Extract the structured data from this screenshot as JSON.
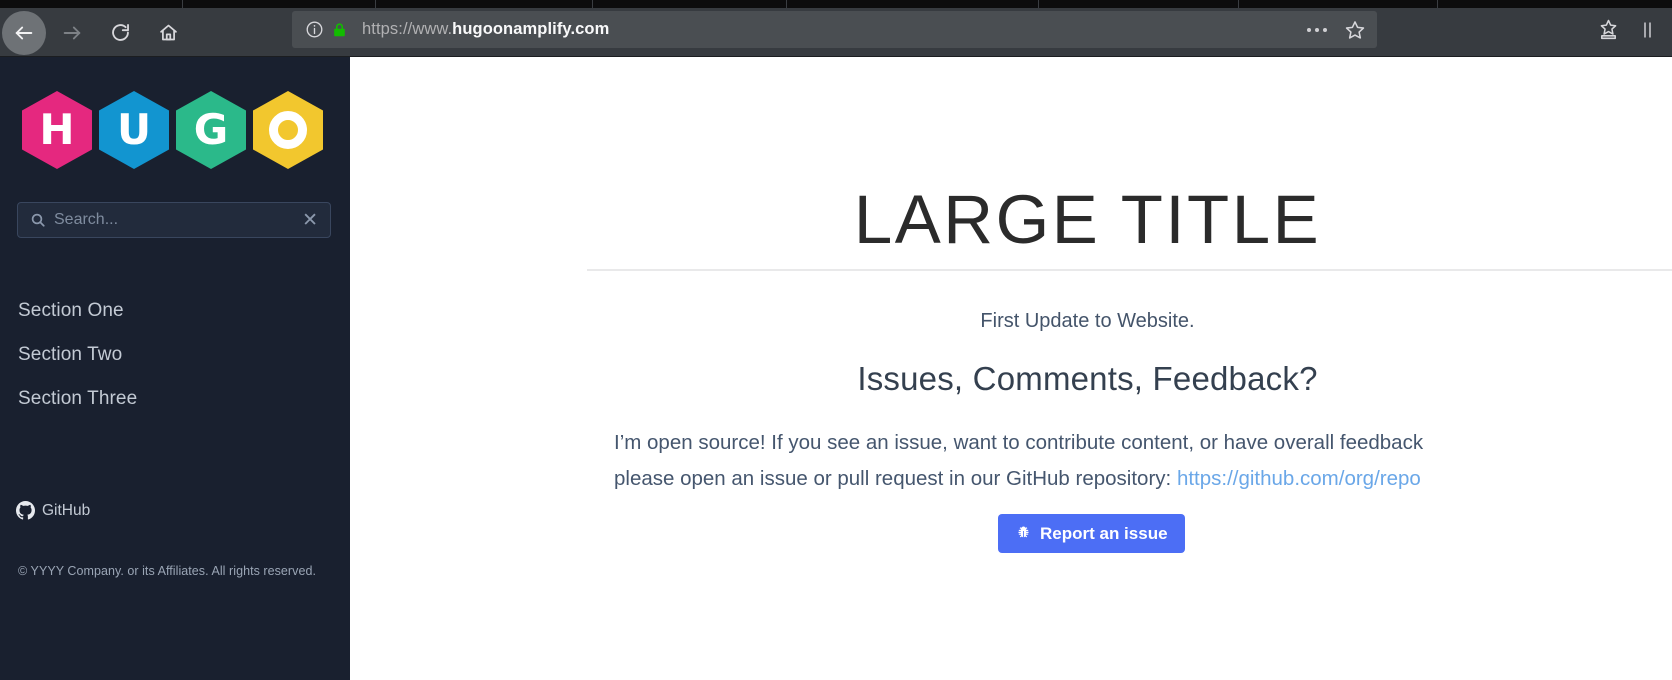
{
  "browser": {
    "nav": {
      "back_label": "Back",
      "forward_label": "Forward",
      "reload_label": "Reload",
      "home_label": "Home"
    },
    "url": {
      "scheme_prefix": "https://www.",
      "host": "hugoonamplify.com",
      "site_info_label": "Site information",
      "lock_label": "Secure connection",
      "page_actions_label": "Page actions",
      "bookmark_label": "Bookmark this page",
      "library_label": "Save to library",
      "sidebar_label": "Sidebar"
    }
  },
  "sidebar": {
    "logo": {
      "alt": "HUGO",
      "tiles": [
        {
          "letter": "H",
          "color": "#e5287f"
        },
        {
          "letter": "U",
          "color": "#1295d0"
        },
        {
          "letter": "G",
          "color": "#2bb98a"
        },
        {
          "letter": "O",
          "color": "#f2c72e"
        }
      ]
    },
    "search": {
      "placeholder": "Search...",
      "value": "",
      "clear_label": "✕"
    },
    "nav_items": [
      {
        "label": "Section One"
      },
      {
        "label": "Section Two"
      },
      {
        "label": "Section Three"
      }
    ],
    "github": {
      "label": "GitHub"
    },
    "copyright": "© YYYY Company. or its Affiliates. All rights reserved."
  },
  "main": {
    "title": "LARGE TITLE",
    "subtitle": "First Update to Website.",
    "section_heading": "Issues, Comments, Feedback?",
    "body_line_1": "I’m open source! If you see an issue, want to contribute content, or have overall feedback",
    "body_line_2_pre": "please open an issue or pull request in our GitHub repository: ",
    "body_link": "https://github.com/org/repo",
    "report_button": "Report an issue"
  }
}
